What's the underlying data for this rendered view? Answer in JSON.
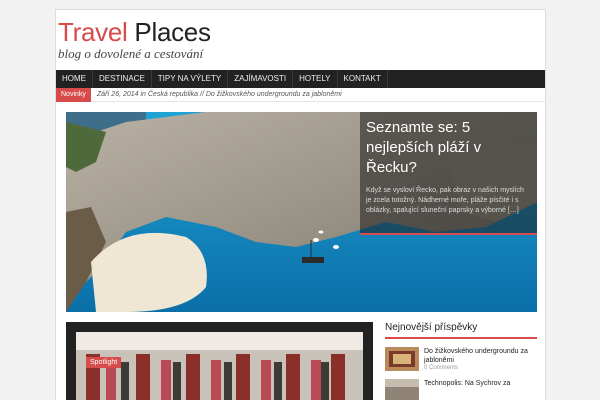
{
  "header": {
    "title_part1": "Travel",
    "title_part2": "Places",
    "tagline": "blog o dovolené a cestování"
  },
  "nav": {
    "items": [
      "HOME",
      "DESTINACE",
      "TIPY NA VÝLETY",
      "ZAJÍMAVOSTI",
      "HOTELY",
      "KONTAKT"
    ]
  },
  "ticker": {
    "label": "Novinky",
    "text": "Září 26, 2014 in Česká republika // Do žižkovského undergroundu za jabloněmi"
  },
  "hero": {
    "title": "Seznamte se: 5 nejlepších pláží v Řecku?",
    "excerpt": "Když se vysloví Řecko, pak obraz v našich myslích je zcela totožný. Nádherné moře, pláže písčité i s oblázky, spalující sluneční paprsky a výborné […]"
  },
  "spotlight": {
    "label": "Spotlight"
  },
  "sidebar": {
    "title": "Nejnovější příspěvky",
    "posts": [
      {
        "title": "Do žižkovského undergroundu za jabloněmi",
        "meta": "0 Comments"
      },
      {
        "title": "Technopolis: Na Sychrov za",
        "meta": ""
      }
    ]
  },
  "colors": {
    "accent": "#d74b4b",
    "nav_bg": "#222222"
  }
}
